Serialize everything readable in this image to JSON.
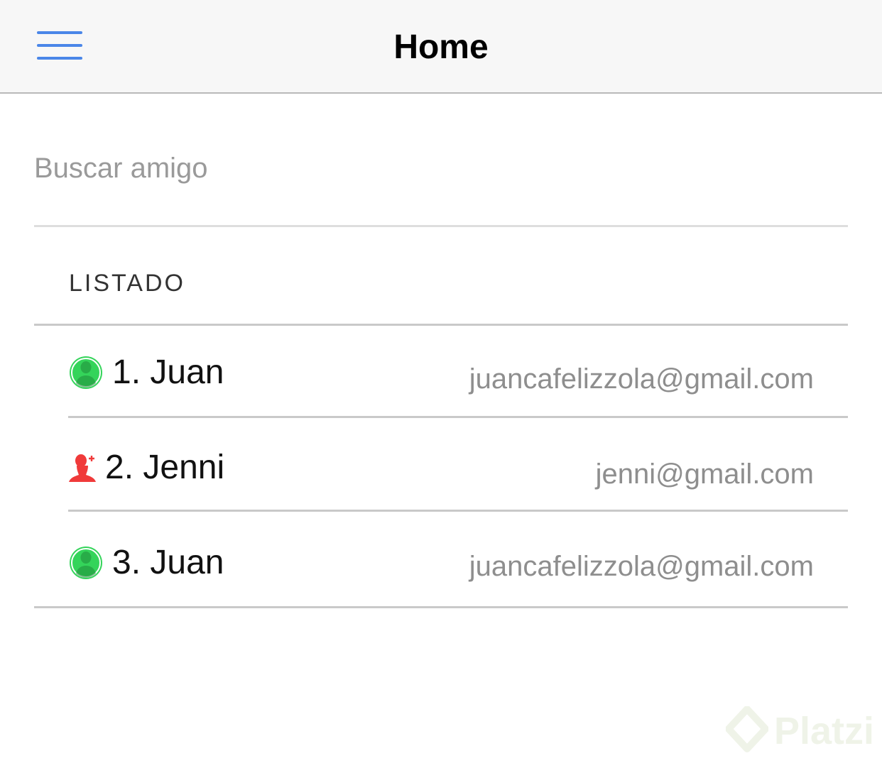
{
  "header": {
    "title": "Home",
    "menu_icon": "hamburger-menu-icon",
    "accent_color": "#4a86e8"
  },
  "search": {
    "placeholder": "Buscar amigo",
    "value": ""
  },
  "section": {
    "title": "LISTADO"
  },
  "list": {
    "items": [
      {
        "name": "1. Juan",
        "email": "juancafelizzola@gmail.com",
        "icon": "user-online-icon",
        "icon_color": "#34d45a"
      },
      {
        "name": "2. Jenni",
        "email": "jenni@gmail.com",
        "icon": "user-add-icon",
        "icon_color": "#f03a3a"
      },
      {
        "name": "3. Juan",
        "email": "juancafelizzola@gmail.com",
        "icon": "user-online-icon",
        "icon_color": "#34d45a"
      }
    ]
  },
  "watermark": {
    "text": "Platzi"
  }
}
